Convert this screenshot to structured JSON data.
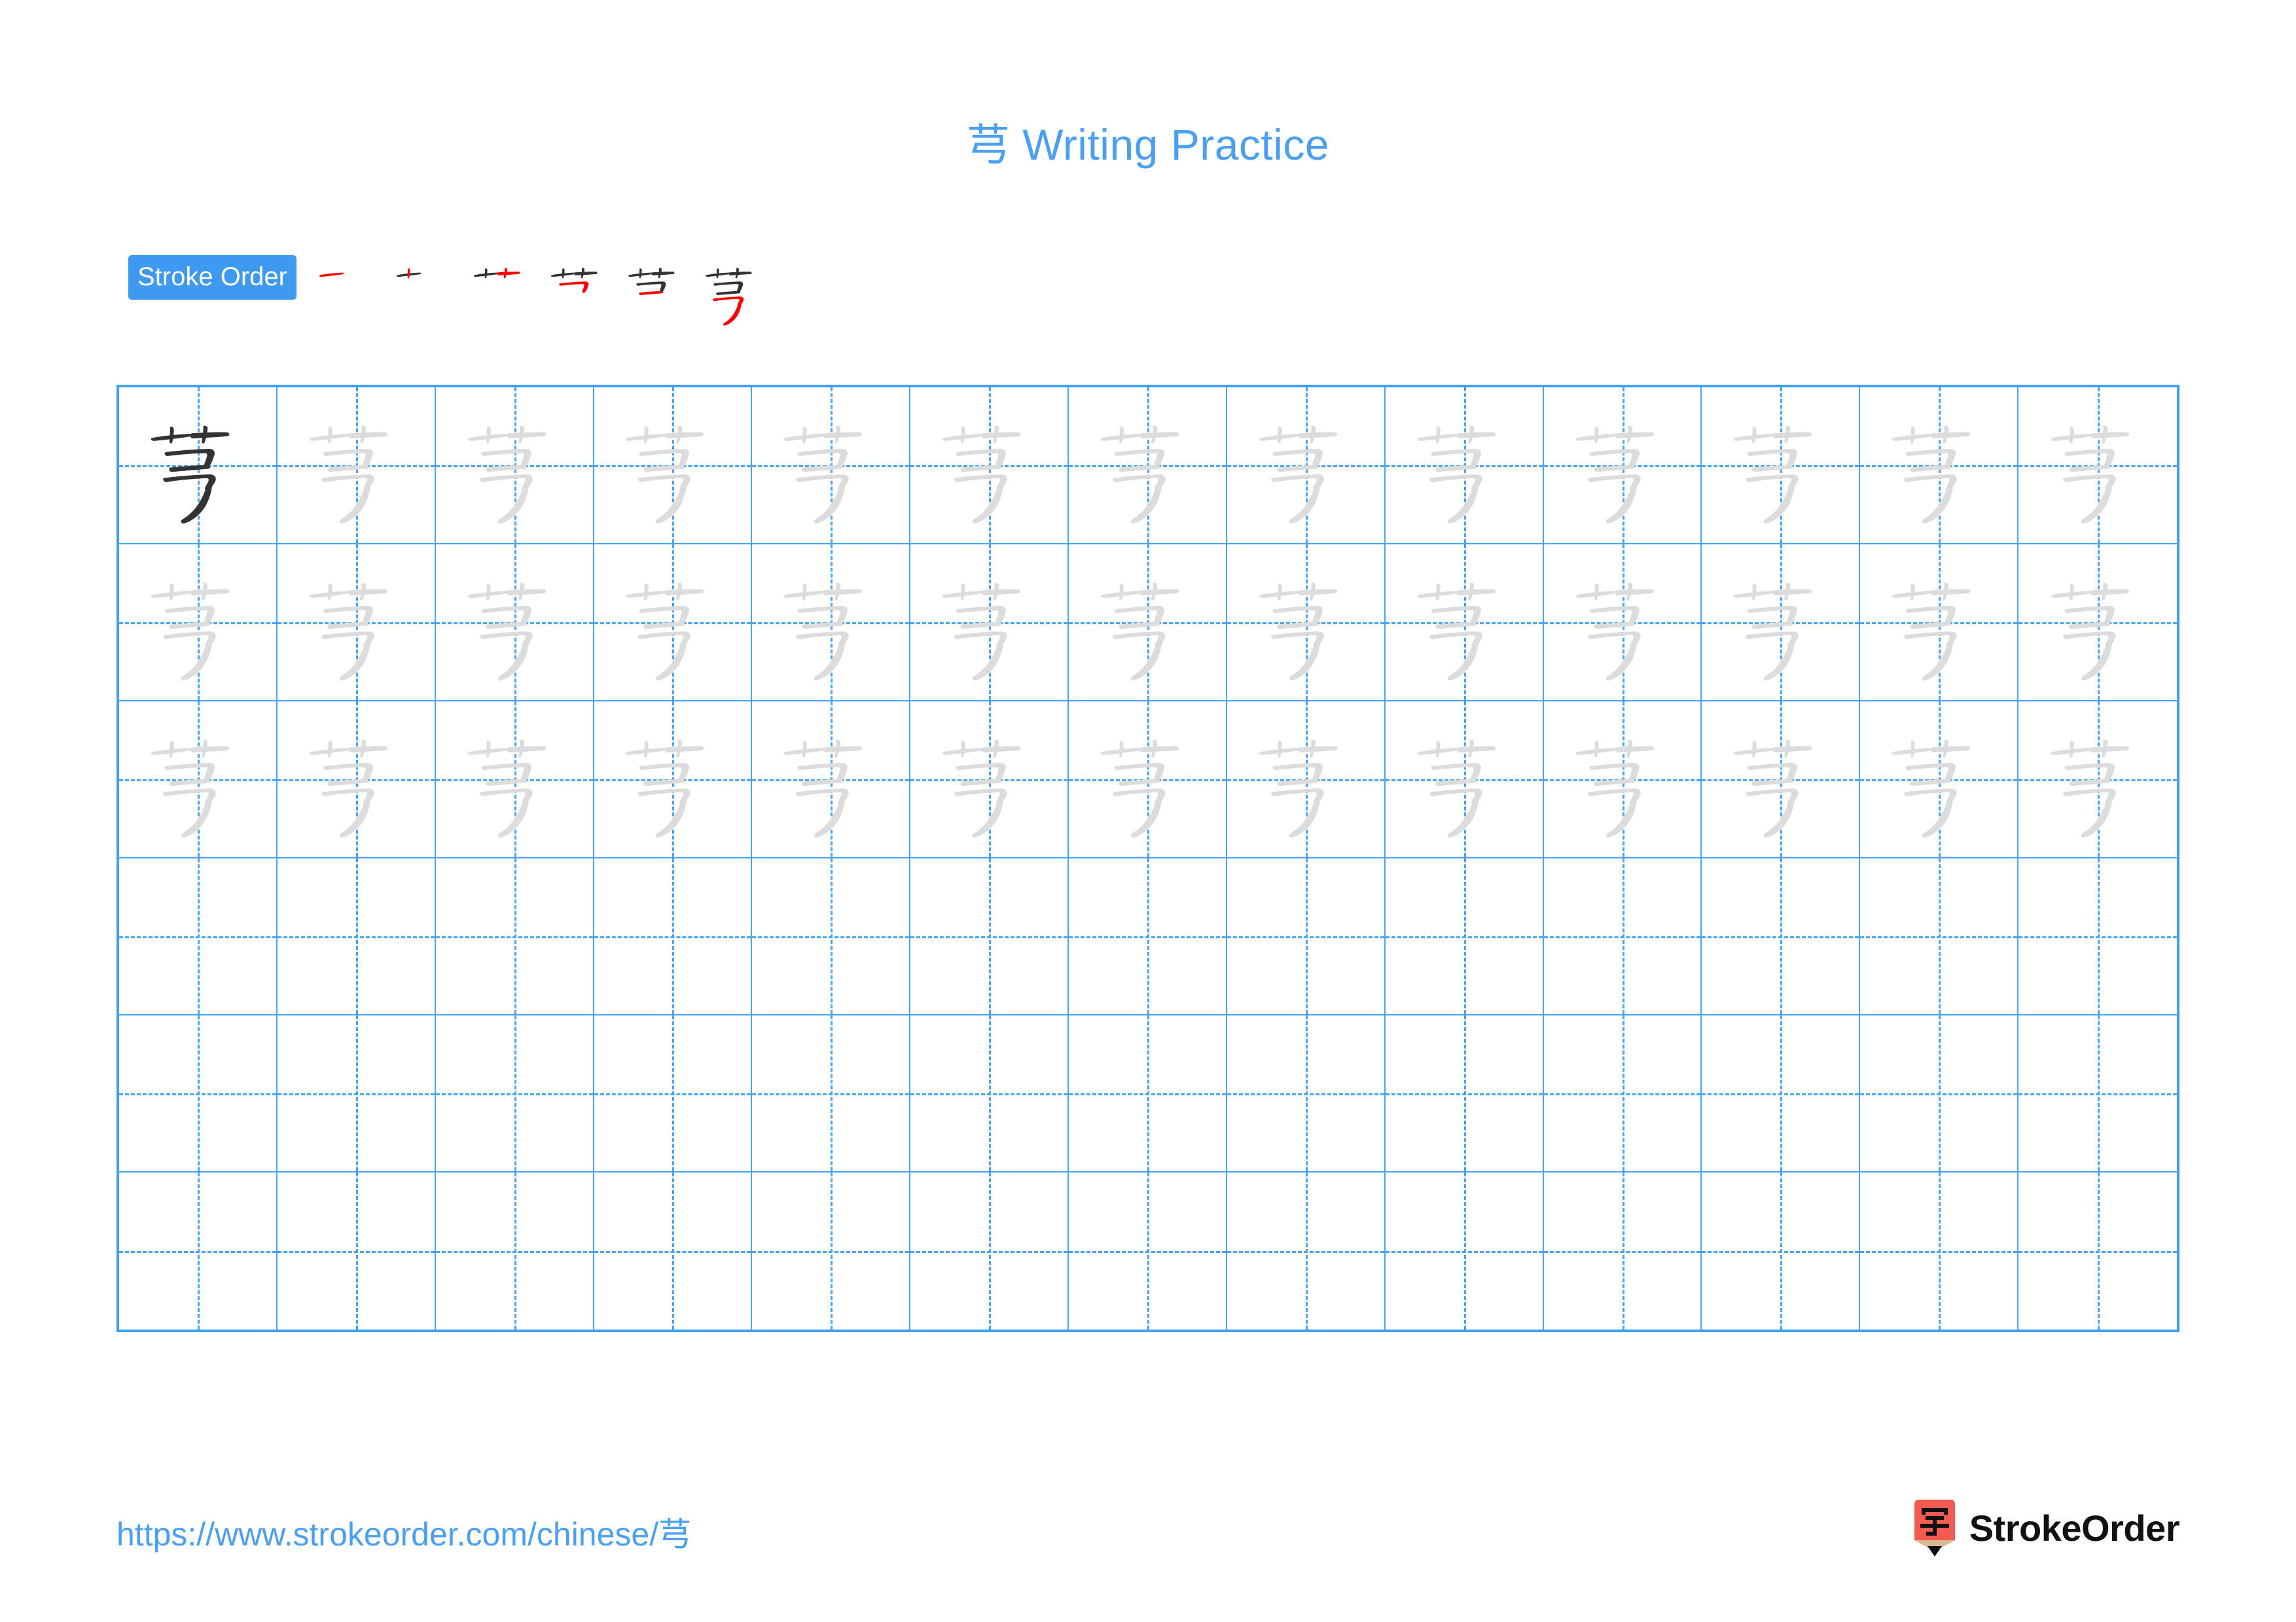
{
  "page": {
    "character": "芎",
    "background_color": "#ffffff"
  },
  "title": {
    "character": "芎",
    "text": " Writing Practice",
    "full": "芎 Writing Practice",
    "color": "#4a9ff0"
  },
  "stroke_order": {
    "badge_label": "Stroke Order",
    "badge_bg_color": "#3d9af0",
    "badge_text_color": "#ffffff",
    "total_strokes": 6,
    "new_stroke_color": "#ff0000",
    "existing_stroke_color": "#333333",
    "steps": [
      {
        "index": 1,
        "strokes_shown": 1,
        "new_stroke": 1
      },
      {
        "index": 2,
        "strokes_shown": 2,
        "new_stroke": 2
      },
      {
        "index": 3,
        "strokes_shown": 3,
        "new_stroke": 3
      },
      {
        "index": 4,
        "strokes_shown": 4,
        "new_stroke": 4
      },
      {
        "index": 5,
        "strokes_shown": 5,
        "new_stroke": 5
      },
      {
        "index": 6,
        "strokes_shown": 6,
        "new_stroke": 6
      }
    ]
  },
  "practice_grid": {
    "columns": 13,
    "rows": 6,
    "border_color": "#3f9ff0",
    "cell_line_color": "#4aa3f2",
    "guide_style": "dashed-crosshair",
    "dark_char_color": "#333333",
    "traced_char_color": "#dcdcdc",
    "rows_data": [
      {
        "row": 1,
        "cells": [
          "dark",
          "trace",
          "trace",
          "trace",
          "trace",
          "trace",
          "trace",
          "trace",
          "trace",
          "trace",
          "trace",
          "trace",
          "trace"
        ]
      },
      {
        "row": 2,
        "cells": [
          "trace",
          "trace",
          "trace",
          "trace",
          "trace",
          "trace",
          "trace",
          "trace",
          "trace",
          "trace",
          "trace",
          "trace",
          "trace"
        ]
      },
      {
        "row": 3,
        "cells": [
          "trace",
          "trace",
          "trace",
          "trace",
          "trace",
          "trace",
          "trace",
          "trace",
          "trace",
          "trace",
          "trace",
          "trace",
          "trace"
        ]
      },
      {
        "row": 4,
        "cells": [
          "empty",
          "empty",
          "empty",
          "empty",
          "empty",
          "empty",
          "empty",
          "empty",
          "empty",
          "empty",
          "empty",
          "empty",
          "empty"
        ]
      },
      {
        "row": 5,
        "cells": [
          "empty",
          "empty",
          "empty",
          "empty",
          "empty",
          "empty",
          "empty",
          "empty",
          "empty",
          "empty",
          "empty",
          "empty",
          "empty"
        ]
      },
      {
        "row": 6,
        "cells": [
          "empty",
          "empty",
          "empty",
          "empty",
          "empty",
          "empty",
          "empty",
          "empty",
          "empty",
          "empty",
          "empty",
          "empty",
          "empty"
        ]
      }
    ]
  },
  "footer": {
    "url_prefix": "https://www.strokeorder.com/chinese/",
    "url_character": "芎",
    "url_full": "https://www.strokeorder.com/chinese/芎",
    "url_color": "#4a9ff0",
    "logo_text": "StrokeOrder",
    "logo_glyph": "字",
    "logo_body_color": "#f15b52",
    "logo_wood_color": "#d9b894",
    "logo_tip_color": "#111111",
    "logo_text_color": "#111111"
  }
}
